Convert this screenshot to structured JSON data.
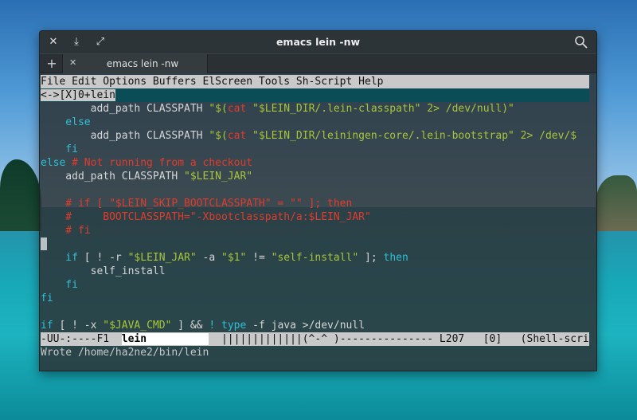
{
  "window": {
    "title": "emacs lein -nw",
    "buttons": {
      "close": "✕",
      "download": "⤓",
      "maximize": "⤢"
    }
  },
  "tabs": {
    "add": "+",
    "items": [
      {
        "close": "✕",
        "label": "emacs lein -nw"
      }
    ]
  },
  "emacs": {
    "menu": "File Edit Options Buffers ElScreen Tools Sh-Script Help",
    "elscreen_tab": "<->[X]0+lein",
    "code": {
      "l1": {
        "pre": "        add_path CLASSPATH ",
        "q1": "\"$(",
        "cmd": "cat",
        "q2": " \"$LEIN_DIR/.lein-classpath\" 2> /dev/null)\""
      },
      "l2": {
        "kw": "    else"
      },
      "l3": {
        "pre": "        add_path CLASSPATH ",
        "q1": "\"$(",
        "cmd": "cat",
        "q2": " \"$LEIN_DIR/leiningen-core/.lein-bootstrap\" 2> /dev/$"
      },
      "l4": {
        "kw": "    fi"
      },
      "l5": {
        "kw": "else",
        "cmt": " # Not running from a checkout"
      },
      "l6": {
        "pre": "    add_path CLASSPATH ",
        "str": "\"$LEIN_JAR\""
      },
      "l8": {
        "cmt": "    # if [ \"$LEIN_SKIP_BOOTCLASSPATH\" = \"\" ]; then"
      },
      "l9": {
        "cmt": "    #     BOOTCLASSPATH=\"-Xbootclasspath/a:$LEIN_JAR\""
      },
      "l10": {
        "cmt": "    # fi"
      },
      "l12": {
        "kw1": "    if",
        "t1": " [ ! -r ",
        "s1": "\"$LEIN_JAR\"",
        "t2": " -a ",
        "s2": "\"$1\"",
        "t3": " != ",
        "s3": "\"self-install\"",
        "t4": " ]; ",
        "kw2": "then"
      },
      "l13": {
        "txt": "        self_install"
      },
      "l14": {
        "kw": "    fi"
      },
      "l15": {
        "kw": "fi"
      },
      "l17": {
        "kw1": "if",
        "t1": " [ ! -x ",
        "s1": "\"$JAVA_CMD\"",
        "t2": " ] && ",
        "kw2": "! type",
        "t3": " -f java >/dev/null"
      }
    },
    "modeline": {
      "left": "-UU-:----F1  ",
      "buffer": "lein          ",
      "right": "  |||||||||||||(^-^ )--------------- L207   [0]   (Shell-scri"
    },
    "minibuffer": "Wrote /home/ha2ne2/bin/lein"
  }
}
